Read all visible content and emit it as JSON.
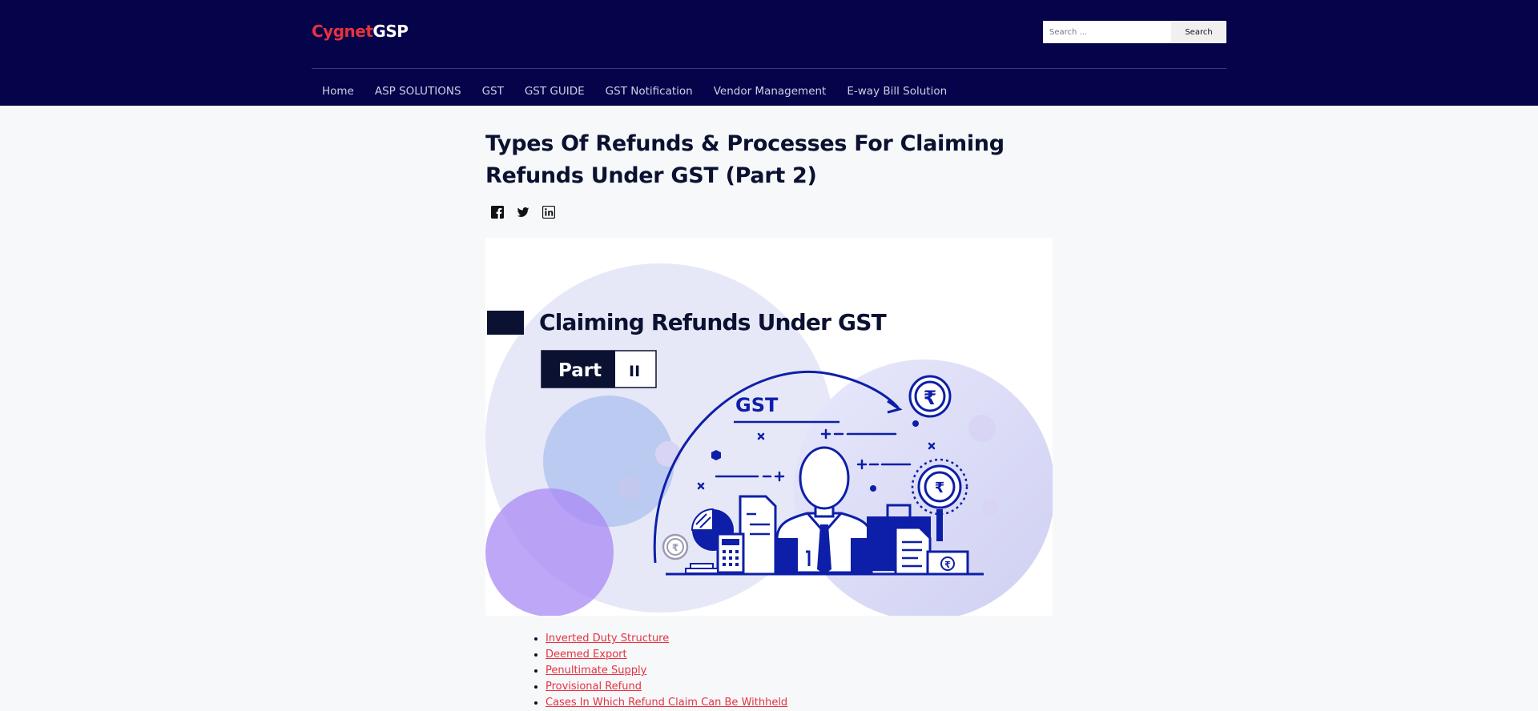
{
  "brand": {
    "part1": "Cygnet",
    "part2": "GSP"
  },
  "search": {
    "placeholder": "Search ...",
    "button_label": "Search"
  },
  "nav": {
    "items": [
      {
        "label": "Home"
      },
      {
        "label": "ASP SOLUTIONS"
      },
      {
        "label": "GST"
      },
      {
        "label": "GST GUIDE"
      },
      {
        "label": "GST Notification"
      },
      {
        "label": "Vendor Management"
      },
      {
        "label": "E-way Bill Solution"
      }
    ]
  },
  "article": {
    "title": "Types Of Refunds & Processes For Claiming Refunds Under GST (Part 2)",
    "share_icons": [
      "facebook-icon",
      "twitter-icon",
      "linkedin-icon"
    ]
  },
  "hero": {
    "heading": "Claiming Refunds Under GST",
    "part_label": "Part",
    "part_number": "II",
    "badge_text": "GST",
    "currency_symbol": "₹"
  },
  "toc": {
    "items": [
      {
        "label": "Inverted Duty Structure"
      },
      {
        "label": "Deemed Export"
      },
      {
        "label": "Penultimate Supply"
      },
      {
        "label": "Provisional Refund"
      },
      {
        "label": "Cases In Which Refund Claim Can Be Withheld"
      }
    ]
  },
  "colors": {
    "header_bg": "#05034a",
    "brand_red": "#e5323f",
    "illustration_blue": "#0d1fa8",
    "navy": "#0b1130"
  }
}
